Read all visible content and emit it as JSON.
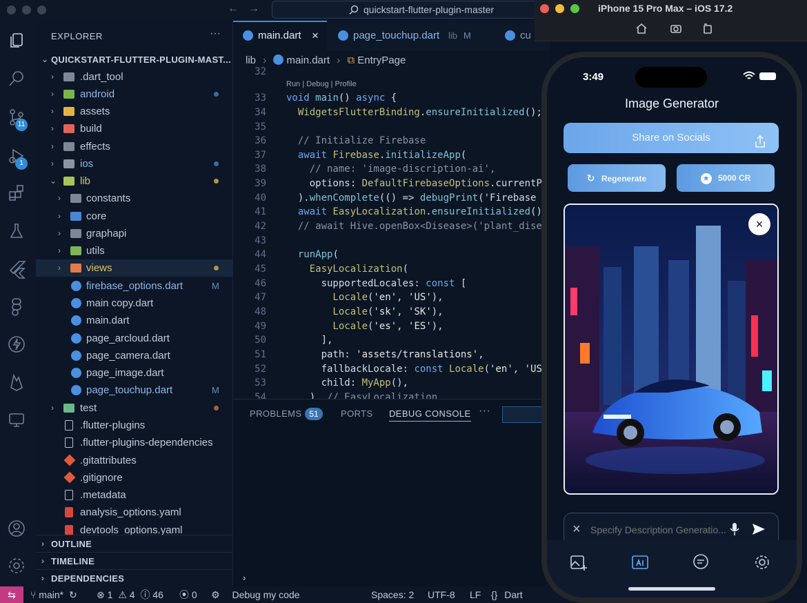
{
  "window": {
    "command_center": "quickstart-flutter-plugin-master"
  },
  "activity_bar": {
    "source_control_badge": "11",
    "debug_badge": "1"
  },
  "explorer": {
    "title": "EXPLORER",
    "root": "QUICKSTART-FLUTTER-PLUGIN-MAST...",
    "items": [
      {
        "label": ".dart_tool"
      },
      {
        "label": "android"
      },
      {
        "label": "assets"
      },
      {
        "label": "build"
      },
      {
        "label": "effects"
      },
      {
        "label": "ios"
      },
      {
        "label": "lib"
      },
      {
        "label": "constants"
      },
      {
        "label": "core"
      },
      {
        "label": "graphapi"
      },
      {
        "label": "utils"
      },
      {
        "label": "views"
      },
      {
        "label": "firebase_options.dart",
        "flag": "M"
      },
      {
        "label": "main copy.dart"
      },
      {
        "label": "main.dart"
      },
      {
        "label": "page_arcloud.dart"
      },
      {
        "label": "page_camera.dart"
      },
      {
        "label": "page_image.dart"
      },
      {
        "label": "page_touchup.dart",
        "flag": "M"
      },
      {
        "label": "test"
      },
      {
        "label": ".flutter-plugins"
      },
      {
        "label": ".flutter-plugins-dependencies"
      },
      {
        "label": ".gitattributes"
      },
      {
        "label": ".gitignore"
      },
      {
        "label": ".metadata"
      },
      {
        "label": "analysis_options.yaml"
      },
      {
        "label": "devtools_options.yaml"
      }
    ],
    "sections": [
      "OUTLINE",
      "TIMELINE",
      "DEPENDENCIES"
    ]
  },
  "editor": {
    "tabs": [
      {
        "label": "main.dart",
        "close": "×"
      },
      {
        "label": "page_touchup.dart",
        "suffix": "lib",
        "flag": "M"
      },
      {
        "label": "cu"
      }
    ],
    "breadcrumb": [
      "lib",
      "main.dart",
      "EntryPage"
    ],
    "codelens": "Run | Debug | Profile",
    "line_numbers": [
      "32",
      "33",
      "34",
      "35",
      "36",
      "37",
      "38",
      "39",
      "40",
      "41",
      "42",
      "43",
      "44",
      "45",
      "46",
      "47",
      "48",
      "49",
      "50",
      "51",
      "52",
      "53",
      "54"
    ]
  },
  "panel": {
    "tabs": [
      "PROBLEMS",
      "PORTS",
      "DEBUG CONSOLE"
    ],
    "problems_count": "51",
    "more": "···",
    "prompt": "›"
  },
  "status_bar": {
    "branch": "main*",
    "errors": "1",
    "warnings": "4",
    "infos": "46",
    "ports": "0",
    "debug": "Debug my code",
    "spaces": "Spaces: 2",
    "encoding": "UTF-8",
    "eol": "LF",
    "language": "Dart"
  },
  "simulator": {
    "title": "iPhone 15 Pro Max – iOS 17.2",
    "time": "3:49",
    "app_title": "Image Generator",
    "share_label": "Share on Socials",
    "regenerate_label": "Regenerate",
    "credits_label": "5000 CR",
    "prompt_placeholder": "Specify Description Generatio...",
    "close_glyph": "×",
    "clear_glyph": "×"
  }
}
